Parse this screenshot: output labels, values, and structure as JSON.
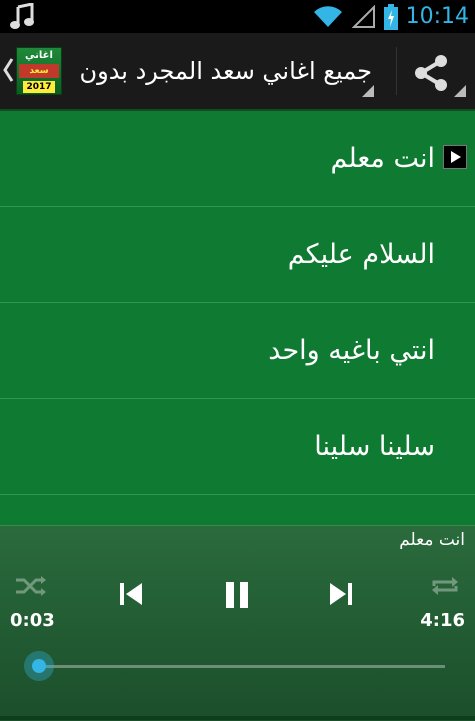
{
  "status_bar": {
    "time": "10:14"
  },
  "action_bar": {
    "title": "جميع اغاني سعد المجرد بدون نت",
    "logo_line1": "اغاني",
    "logo_line2": "سعد المجرد",
    "logo_year": "2017"
  },
  "songs": [
    {
      "title": "انت معلم",
      "playing": true
    },
    {
      "title": "السلام عليكم",
      "playing": false
    },
    {
      "title": "انتي باغيه واحد",
      "playing": false
    },
    {
      "title": "سلينا سلينا",
      "playing": false
    }
  ],
  "player": {
    "now_playing": "انت معلم",
    "current_time": "0:03",
    "duration": "4:16",
    "progress_fraction": 0.012
  },
  "colors": {
    "background": "#0f7a32",
    "accent": "#33b5e5"
  }
}
